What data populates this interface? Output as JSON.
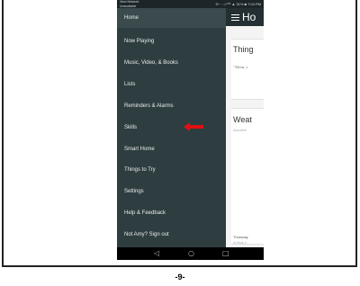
{
  "status_bar": {
    "left_line1": "View Network",
    "left_line2": "Unavailable",
    "right": "⊖⋯ ☼ᴸᵀᴱ ▲ 31% ■ 7:04 PM"
  },
  "drawer": {
    "items": [
      {
        "label": "Home"
      },
      {
        "label": "Now Playing"
      },
      {
        "label": "Music, Video, & Books"
      },
      {
        "label": "Lists"
      },
      {
        "label": "Reminders & Alarms"
      },
      {
        "label": "Skills"
      },
      {
        "label": "Smart Home"
      },
      {
        "label": "Things to Try"
      },
      {
        "label": "Settings"
      },
      {
        "label": "Help & Feedback"
      },
      {
        "label": "Not Amy? Sign out"
      }
    ]
  },
  "content": {
    "appbar_title": "Ho",
    "card1_title": "Thing",
    "card1_sub": "\"Alexa, v",
    "card2_title": "Weat",
    "card2_sub": "AccuWe",
    "card2_footer": "Thursday",
    "card2_footer2": "A thick c"
  },
  "nav": {
    "back": "◁",
    "home": "○",
    "recent": "□"
  },
  "page_number": "-9-",
  "colors": {
    "drawer_bg": "#2e3d40",
    "appbar_bg": "#232f32",
    "arrow": "#e01010"
  }
}
